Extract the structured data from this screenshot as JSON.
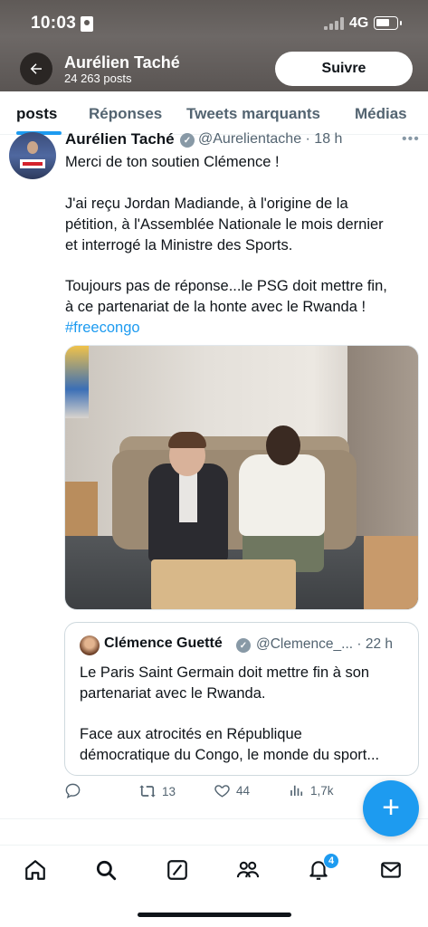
{
  "status_bar": {
    "time": "10:03",
    "network": "4G"
  },
  "header": {
    "name": "Aurélien Taché",
    "post_count": "24 263 posts",
    "follow_label": "Suivre"
  },
  "tabs": [
    {
      "label": "posts"
    },
    {
      "label": "Réponses"
    },
    {
      "label": "Tweets marquants"
    },
    {
      "label": "Médias"
    }
  ],
  "tweet": {
    "author": "Aurélien Taché",
    "handle_time": "@Aurelientache · 18 h",
    "lines": [
      "Merci de ton soutien Clémence !",
      "J'ai reçu Jordan Madiande, à l'origine de la",
      "pétition, à l'Assemblée Nationale le mois dernier",
      "et interrogé la Ministre des Sports.",
      "Toujours pas de réponse...le PSG doit mettre fin,",
      "à ce partenariat de la honte avec le Rwanda !"
    ],
    "hashtag": "#freecongo",
    "quote": {
      "author": "Clémence Guetté",
      "handle_time": "@Clemence_... · 22 h",
      "lines": [
        "Le Paris Saint Germain doit mettre fin à son",
        "partenariat avec le Rwanda.",
        "Face aux atrocités en République",
        "démocratique du Congo, le monde du sport..."
      ]
    },
    "actions": {
      "retweets": "13",
      "likes": "44",
      "views": "1,7k"
    }
  },
  "nav": {
    "notifications_badge": "4"
  },
  "icons": [
    "back-arrow-icon",
    "verified-icon",
    "more-icon",
    "reply-icon",
    "retweet-icon",
    "like-icon",
    "views-icon",
    "home-icon",
    "search-icon",
    "grok-icon",
    "communities-icon",
    "notifications-icon",
    "messages-icon",
    "compose-icon"
  ],
  "colors": {
    "accent": "#1d9bf0",
    "text": "#0f1419",
    "muted": "#536471"
  }
}
